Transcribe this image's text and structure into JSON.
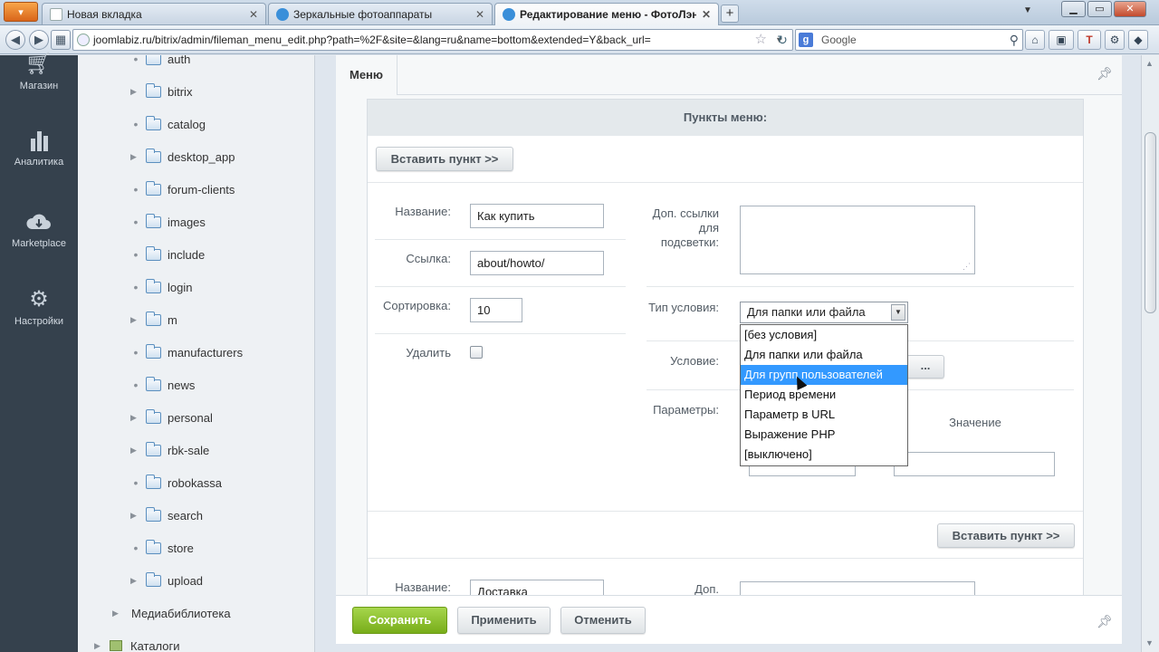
{
  "browser": {
    "app_button": "",
    "tabs": [
      {
        "label": "Новая вкладка",
        "active": false
      },
      {
        "label": "Зеркальные фотоаппараты",
        "active": false
      },
      {
        "label": "Редактирование меню - ФотоЛэнд",
        "active": true
      }
    ],
    "new_tab": "+",
    "url": "joomlabiz.ru/bitrix/admin/fileman_menu_edit.php?path=%2F&site=&lang=ru&name=bottom&extended=Y&back_url=",
    "search_placeholder": "Google"
  },
  "admin_menu": [
    {
      "label": "Магазин",
      "icon": "cart-icon"
    },
    {
      "label": "Аналитика",
      "icon": "bar-chart-icon"
    },
    {
      "label": "Marketplace",
      "icon": "cloud-download-icon"
    },
    {
      "label": "Настройки",
      "icon": "gear-icon"
    }
  ],
  "tree": {
    "folders": [
      "auth",
      "bitrix",
      "catalog",
      "desktop_app",
      "forum-clients",
      "images",
      "include",
      "login",
      "m",
      "manufacturers",
      "news",
      "personal",
      "rbk-sale",
      "robokassa",
      "search",
      "store",
      "upload"
    ],
    "media_library": "Медиабиблиотека",
    "catalogs": "Каталоги"
  },
  "main": {
    "tab_label": "Меню",
    "section_title": "Пункты меню:",
    "insert_button": "Вставить пункт >>",
    "item1": {
      "name_label": "Название:",
      "name_value": "Как купить",
      "link_label": "Ссылка:",
      "link_value": "about/howto/",
      "sort_label": "Сортировка:",
      "sort_value": "10",
      "delete_label": "Удалить",
      "extra_links_label": "Доп. ссылки для подсветки:",
      "condition_type_label": "Тип условия:",
      "condition_type_value": "Для папки или файла",
      "condition_label": "Условие:",
      "condition_button": "...",
      "params_label": "Параметры:",
      "value_label": "Значение",
      "dropdown_options": [
        "[без условия]",
        "Для папки или файла",
        "Для групп пользователей",
        "Период времени",
        "Параметр в URL",
        "Выражение PHP",
        "[выключено]"
      ],
      "highlighted_option": "Для групп пользователей"
    },
    "insert_button_2": "Вставить пункт >>",
    "item2": {
      "name_label": "Название:",
      "name_value": "Доставка",
      "extra_label": "Доп."
    }
  },
  "actions": {
    "save": "Сохранить",
    "apply": "Применить",
    "cancel": "Отменить"
  }
}
